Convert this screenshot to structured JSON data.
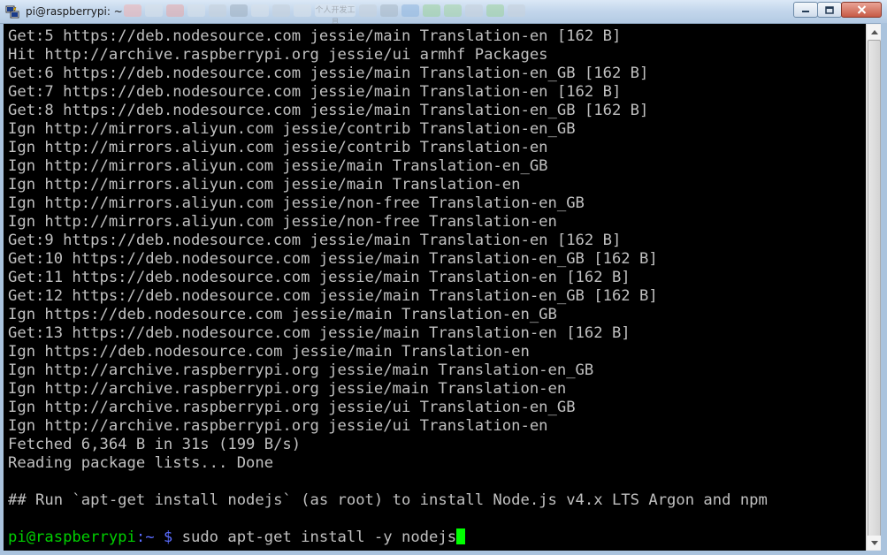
{
  "window": {
    "title": "pi@raspberrypi: ~",
    "taskbar_text": "个人开发工具",
    "controls": {
      "minimize_icon": "minimize-icon",
      "maximize_icon": "maximize-icon",
      "close_icon": "close-icon"
    }
  },
  "terminal": {
    "lines": [
      "Get:5 https://deb.nodesource.com jessie/main Translation-en [162 B]",
      "Hit http://archive.raspberrypi.org jessie/ui armhf Packages",
      "Get:6 https://deb.nodesource.com jessie/main Translation-en_GB [162 B]",
      "Get:7 https://deb.nodesource.com jessie/main Translation-en [162 B]",
      "Get:8 https://deb.nodesource.com jessie/main Translation-en_GB [162 B]",
      "Ign http://mirrors.aliyun.com jessie/contrib Translation-en_GB",
      "Ign http://mirrors.aliyun.com jessie/contrib Translation-en",
      "Ign http://mirrors.aliyun.com jessie/main Translation-en_GB",
      "Ign http://mirrors.aliyun.com jessie/main Translation-en",
      "Ign http://mirrors.aliyun.com jessie/non-free Translation-en_GB",
      "Ign http://mirrors.aliyun.com jessie/non-free Translation-en",
      "Get:9 https://deb.nodesource.com jessie/main Translation-en [162 B]",
      "Get:10 https://deb.nodesource.com jessie/main Translation-en_GB [162 B]",
      "Get:11 https://deb.nodesource.com jessie/main Translation-en [162 B]",
      "Get:12 https://deb.nodesource.com jessie/main Translation-en_GB [162 B]",
      "Ign https://deb.nodesource.com jessie/main Translation-en_GB",
      "Get:13 https://deb.nodesource.com jessie/main Translation-en [162 B]",
      "Ign https://deb.nodesource.com jessie/main Translation-en",
      "Ign http://archive.raspberrypi.org jessie/main Translation-en_GB",
      "Ign http://archive.raspberrypi.org jessie/main Translation-en",
      "Ign http://archive.raspberrypi.org jessie/ui Translation-en_GB",
      "Ign http://archive.raspberrypi.org jessie/ui Translation-en",
      "Fetched 6,364 B in 31s (199 B/s)",
      "Reading package lists... Done",
      "",
      "## Run `apt-get install nodejs` (as root) to install Node.js v4.x LTS Argon and npm",
      ""
    ],
    "prompt": {
      "user_host": "pi@raspberrypi",
      "path": ":~ $",
      "command": " sudo apt-get install -y nodejs"
    },
    "colors": {
      "background": "#000000",
      "text": "#c0c0c0",
      "prompt_user": "#00d000",
      "prompt_path": "#5a6cff",
      "cursor": "#00ff00"
    }
  }
}
